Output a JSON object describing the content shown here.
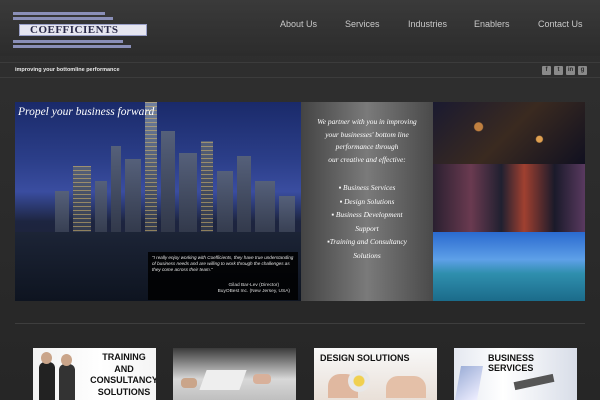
{
  "header": {
    "logo_text": "COEFFICIENTS",
    "nav": [
      {
        "label": "About Us"
      },
      {
        "label": "Services"
      },
      {
        "label": "Industries"
      },
      {
        "label": "Enablers"
      },
      {
        "label": "Contact Us"
      }
    ]
  },
  "tagline": "improving your bottomline performance",
  "social": [
    {
      "icon": "facebook-icon",
      "glyph": "f"
    },
    {
      "icon": "twitter-icon",
      "glyph": "t"
    },
    {
      "icon": "linkedin-icon",
      "glyph": "in"
    },
    {
      "icon": "google-plus-icon",
      "glyph": "g"
    }
  ],
  "banner": {
    "heading": "Propel your business forward",
    "partner_lines": [
      "We partner with you in improving",
      "your businesses' bottom line",
      "performance through",
      "our creative and effective:"
    ],
    "services": [
      "▪ Business Services",
      "▪ Design Solutions",
      "▪ Business Development",
      "Support",
      "▪Training and Consultancy",
      "Solutions"
    ],
    "quote": "\"I really enjoy working with Coefficients, they have true understanding of business needs and are willing to work through the challenges as they come across their team.\"",
    "quote_author_name": "Gilad Bar-Lev (Director)",
    "quote_author_company": "BuyOBest Inc. (New Jersey, USA)"
  },
  "tiles": [
    {
      "title_lines": [
        "TRAINING",
        "AND",
        "CONSULTANCY",
        "SOLUTIONS"
      ]
    },
    {
      "title_lines": []
    },
    {
      "title_lines": [
        "DESIGN SOLUTIONS"
      ]
    },
    {
      "title_lines": [
        "BUSINESS SERVICES"
      ]
    }
  ]
}
